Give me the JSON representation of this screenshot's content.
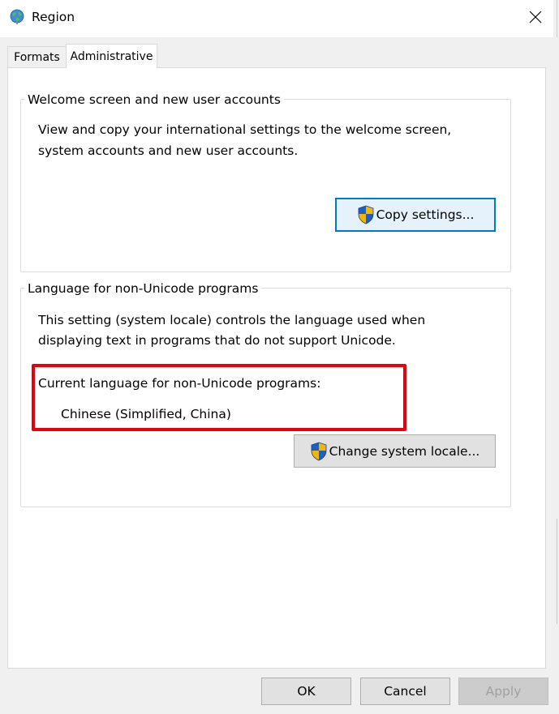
{
  "window": {
    "title": "Region",
    "icon": "globe-icon",
    "close_icon": "close-icon"
  },
  "tabs": [
    {
      "label": "Formats",
      "selected": false
    },
    {
      "label": "Administrative",
      "selected": true
    }
  ],
  "welcome_group": {
    "legend": "Welcome screen and new user accounts",
    "description_line1": "View and copy your international settings to the welcome screen,",
    "description_line2": "system accounts and new user accounts.",
    "button_label": "Copy settings...",
    "button_icon": "uac-shield-icon"
  },
  "nonunicode_group": {
    "legend": "Language for non-Unicode programs",
    "description_line1": "This setting (system locale) controls the language used when",
    "description_line2": "displaying text in programs that do not support Unicode.",
    "current_label": "Current language for non-Unicode programs:",
    "current_value": "Chinese (Simplified, China)",
    "button_label": "Change system locale...",
    "button_icon": "uac-shield-icon"
  },
  "footer": {
    "ok_label": "OK",
    "cancel_label": "Cancel",
    "apply_label": "Apply",
    "apply_enabled": false
  },
  "colors": {
    "highlight": "#e8000e",
    "accent": "#0078d7"
  }
}
